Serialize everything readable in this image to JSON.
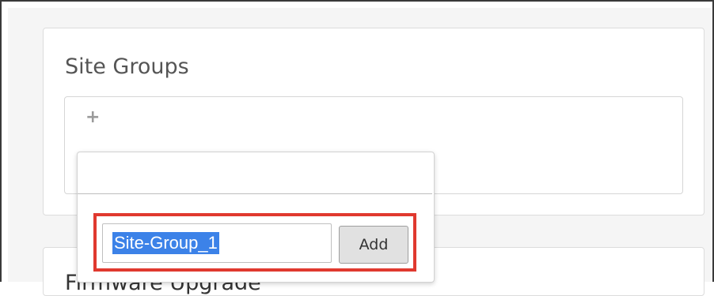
{
  "site_groups": {
    "title": "Site Groups",
    "add_icon": "plus-icon",
    "popover": {
      "search_value": "",
      "new_group_input": "Site-Group_1",
      "add_button_label": "Add"
    }
  },
  "firmware_card": {
    "title": "Firmware Upgrade"
  },
  "colors": {
    "highlight_border": "#e0392f",
    "text_selection": "#3c82e8",
    "card_title": "#555555"
  }
}
